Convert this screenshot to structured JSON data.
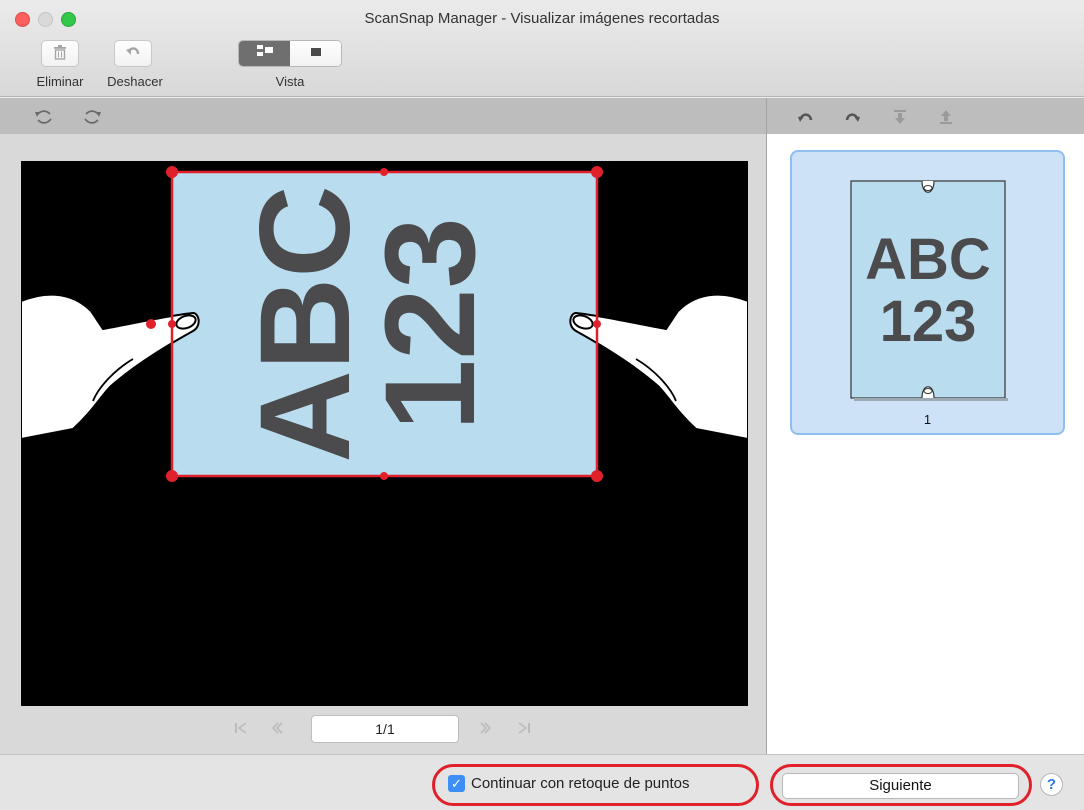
{
  "window": {
    "title": "ScanSnap Manager - Visualizar imágenes recortadas"
  },
  "toolbar": {
    "delete_label": "Eliminar",
    "undo_label": "Deshacer",
    "view_label": "Vista"
  },
  "preview": {
    "image_text_line1": "ABC",
    "image_text_line2": "123"
  },
  "pagination": {
    "page_value": "1/1"
  },
  "thumbnails": [
    {
      "text_line1": "ABC",
      "text_line2": "123",
      "label": "1"
    }
  ],
  "footer": {
    "checkbox_label": "Continuar con retoque de puntos",
    "checkbox_checked": true,
    "next_label": "Siguiente",
    "help_label": "?"
  },
  "colors": {
    "accent_red": "#e0202a",
    "document_blue": "#b9ddef",
    "text_dark": "#4b4b4d",
    "selection_blue": "#cde2f6"
  }
}
